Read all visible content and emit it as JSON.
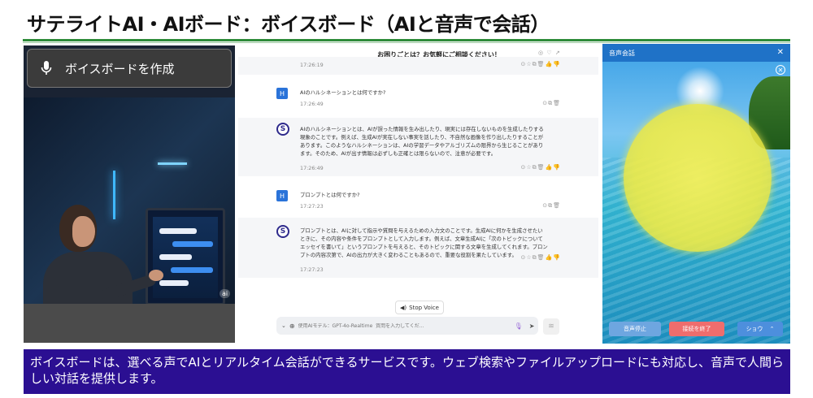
{
  "slide": {
    "title": "サテライトAI・AIボード：ボイスボード（AIと音声で会話）",
    "caption": "ボイスボードは、選べる声でAIとリアルタイム会話ができるサービスです。ウェブ検索やファイルアップロードにも対応し、音声で人間らしい対話を提供します。"
  },
  "left_panel": {
    "create_button_label": "ボイスボードを作成",
    "badge": "ai"
  },
  "chat": {
    "header_title": "お困りごとは？お気軽にご相談ください！",
    "messages": [
      {
        "role": "bot",
        "text": "",
        "time": "17:26:19"
      },
      {
        "role": "user",
        "avatar": "H",
        "text": "AIのハルシネーションとは何ですか?",
        "time": "17:26:49"
      },
      {
        "role": "bot",
        "avatar": "S",
        "text": "AIのハルシネーションとは、AIが誤った情報を生み出したり、現実には存在しないものを生成したりする現象のことです。例えば、生成AIが実在しない事実を話したり、不自然な画像を作り出したりすることがあります。このようなハルシネーションは、AIの学習データやアルゴリズムの限界から生じることがあります。そのため、AIが出す情報は必ずしも正確とは限らないので、注意が必要です。",
        "time": "17:26:49"
      },
      {
        "role": "user",
        "avatar": "H",
        "text": "プロンプトとは何ですか?",
        "time": "17:27:23"
      },
      {
        "role": "bot",
        "avatar": "S",
        "text": "プロンプトとは、AIに対して指示や質問を与えるための入力文のことです。生成AIに何かを生成させたいときに、その内容や条件をプロンプトとして入力します。例えば、文章生成AIに「次のトピックについてエッセイを書いて」というプロンプトを与えると、そのトピックに関する文章を生成してくれます。プロンプトの内容次第で、AIの出力が大きく変わることもあるので、重要な役割を果たしています。",
        "time": "17:27:23"
      }
    ],
    "stop_voice_label": "Stop Voice",
    "input_placeholder": "使用AIモデル：GPT-4o-Realtime  質問を入力してくだ..."
  },
  "voice_panel": {
    "title": "音声会話",
    "stop_button": "音声停止",
    "end_button": "接続を終了",
    "show_button": "ショウ"
  },
  "colors": {
    "title_rule": "#2e8b3a",
    "caption_bg": "#2b0f92",
    "end_button": "#ef6d6d",
    "orb": "#f0eb4a"
  }
}
